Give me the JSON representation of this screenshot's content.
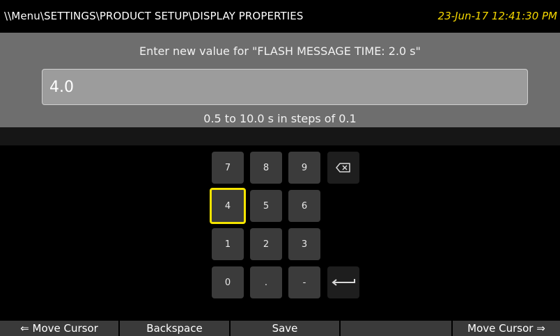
{
  "header": {
    "path": "\\\\Menu\\SETTINGS\\PRODUCT SETUP\\DISPLAY PROPERTIES",
    "datetime": "23-Jun-17 12:41:30 PM"
  },
  "dialog": {
    "prompt": "Enter new value for \"FLASH MESSAGE TIME: 2.0 s\"",
    "value": "4.0",
    "range_hint": "0.5 to 10.0 s in steps of 0.1"
  },
  "keypad": {
    "keys": [
      "7",
      "8",
      "9",
      "4",
      "5",
      "6",
      "1",
      "2",
      "3",
      "0",
      ".",
      "-"
    ],
    "selected_key": "4",
    "backspace_icon": "backspace-icon",
    "enter_icon": "enter-arrow-icon"
  },
  "softkeys": {
    "move_left": "⇐ Move Cursor",
    "backspace": "Backspace",
    "save": "Save",
    "empty": "",
    "move_right": "Move Cursor ⇒"
  },
  "colors": {
    "accent_yellow": "#f5e400",
    "panel_gray": "#6e6e6e",
    "key_gray": "#3b3b3b"
  }
}
